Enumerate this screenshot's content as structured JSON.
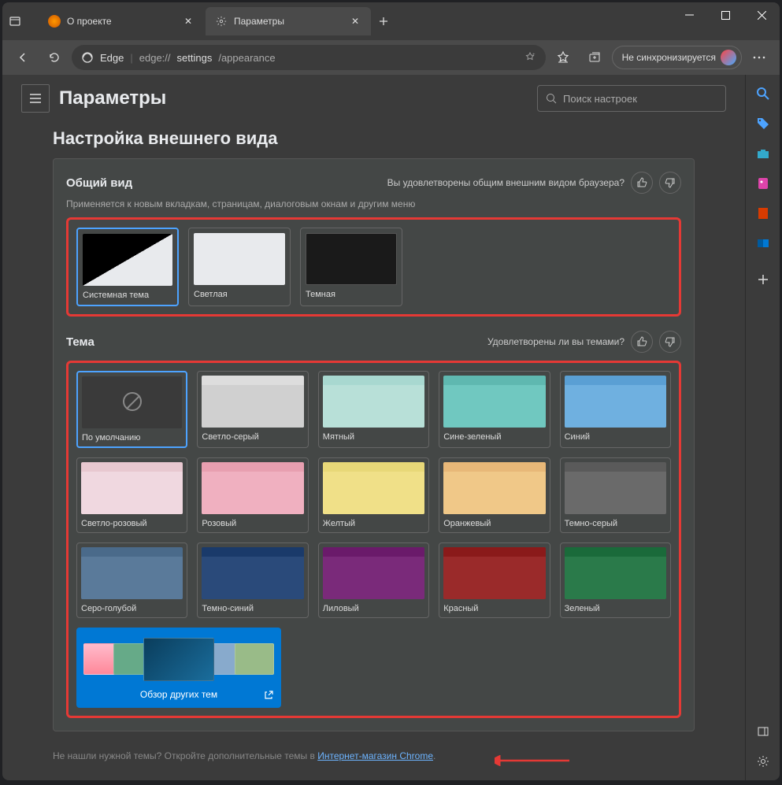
{
  "tabs": [
    {
      "title": "О проекте"
    },
    {
      "title": "Параметры"
    }
  ],
  "address": {
    "brand": "Edge",
    "url_prefix": "edge://",
    "url_bold": "settings",
    "url_rest": "/appearance"
  },
  "sync_label": "Не синхронизируется",
  "page_title": "Параметры",
  "search_placeholder": "Поиск настроек",
  "section_title": "Настройка внешнего вида",
  "overall": {
    "title": "Общий вид",
    "feedback": "Вы удовлетворены общим внешним видом браузера?",
    "subtitle": "Применяется к новым вкладкам, страницам, диалоговым окнам и другим меню",
    "modes": [
      {
        "label": "Системная тема"
      },
      {
        "label": "Светлая"
      },
      {
        "label": "Темная"
      }
    ]
  },
  "theme": {
    "title": "Тема",
    "feedback": "Удовлетворены ли вы темами?",
    "items": [
      {
        "label": "По умолчанию",
        "tab": "#555",
        "body": "#3a3a3a",
        "default": true
      },
      {
        "label": "Светло-серый",
        "tab": "#ddd",
        "body": "#d0d0d0"
      },
      {
        "label": "Мятный",
        "tab": "#a8d8d0",
        "body": "#b8e0d8"
      },
      {
        "label": "Сине-зеленый",
        "tab": "#5fb8b0",
        "body": "#70c8c0"
      },
      {
        "label": "Синий",
        "tab": "#5a9fd4",
        "body": "#6fb0e0"
      },
      {
        "label": "Светло-розовый",
        "tab": "#e8c8d0",
        "body": "#f0d8e0"
      },
      {
        "label": "Розовый",
        "tab": "#e89fb0",
        "body": "#f0b0c0"
      },
      {
        "label": "Желтый",
        "tab": "#e8d878",
        "body": "#f0e088"
      },
      {
        "label": "Оранжевый",
        "tab": "#e8b878",
        "body": "#f0c888"
      },
      {
        "label": "Темно-серый",
        "tab": "#5a5a5a",
        "body": "#6a6a6a"
      },
      {
        "label": "Серо-голубой",
        "tab": "#4a6a8a",
        "body": "#5a7a9a"
      },
      {
        "label": "Темно-синий",
        "tab": "#1a3a6a",
        "body": "#2a4a7a"
      },
      {
        "label": "Лиловый",
        "tab": "#6a1a6a",
        "body": "#7a2a7a"
      },
      {
        "label": "Красный",
        "tab": "#8a1a1a",
        "body": "#9a2a2a"
      },
      {
        "label": "Зеленый",
        "tab": "#1a6a3a",
        "body": "#2a7a4a"
      }
    ],
    "browse_label": "Обзор других тем"
  },
  "footer": {
    "text": "Не нашли нужной темы? Откройте дополнительные темы в ",
    "link": "Интернет-магазин Chrome",
    "dot": "."
  }
}
